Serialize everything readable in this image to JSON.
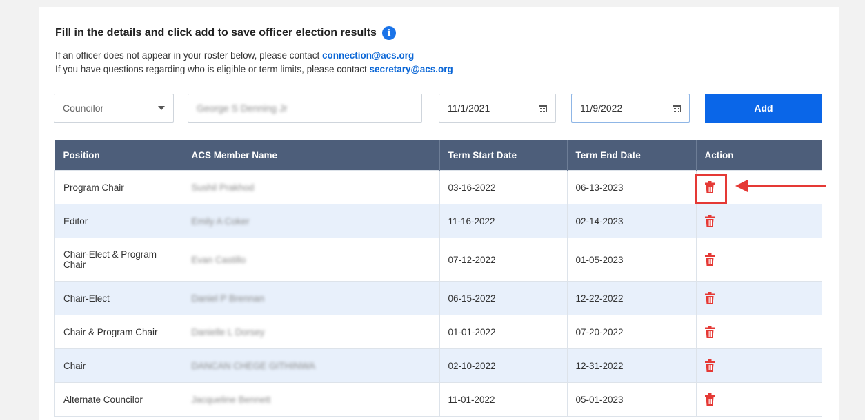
{
  "header": {
    "title": "Fill in the details and click add to save officer election results",
    "info_icon": "info-icon",
    "line1_prefix": "If an officer does not appear in your roster below, please contact ",
    "line1_email": "connection@acs.org",
    "line2_prefix": "If you have questions regarding who is eligible or term limits, please contact ",
    "line2_email": "secretary@acs.org"
  },
  "form": {
    "position_selected": "Councilor",
    "member_name_value": "George S Denning Jr",
    "term_start_value": "11/1/2021",
    "term_end_value": "11/9/2022",
    "add_label": "Add"
  },
  "table": {
    "columns": [
      "Position",
      "ACS Member Name",
      "Term Start Date",
      "Term End Date",
      "Action"
    ],
    "rows": [
      {
        "position": "Program Chair",
        "member": "Sushil Prakhod",
        "start": "03-16-2022",
        "end": "06-13-2023"
      },
      {
        "position": "Editor",
        "member": "Emily A Coker",
        "start": "11-16-2022",
        "end": "02-14-2023"
      },
      {
        "position": "Chair-Elect & Program Chair",
        "member": "Evan Castillo",
        "start": "07-12-2022",
        "end": "01-05-2023"
      },
      {
        "position": "Chair-Elect",
        "member": "Daniel P Brennan",
        "start": "06-15-2022",
        "end": "12-22-2022"
      },
      {
        "position": "Chair & Program Chair",
        "member": "Danielle L Dorsey",
        "start": "01-01-2022",
        "end": "07-20-2022"
      },
      {
        "position": "Chair",
        "member": "DANCAN CHEGE GITHINWA",
        "start": "02-10-2022",
        "end": "12-31-2022"
      },
      {
        "position": "Alternate Councilor",
        "member": "Jacqueline Bennett",
        "start": "11-01-2022",
        "end": "05-01-2023"
      }
    ]
  },
  "colors": {
    "accent": "#0a66e8",
    "header_bg": "#4d5e7a",
    "delete_icon": "#e53935",
    "alt_row": "#e8f0fb"
  }
}
